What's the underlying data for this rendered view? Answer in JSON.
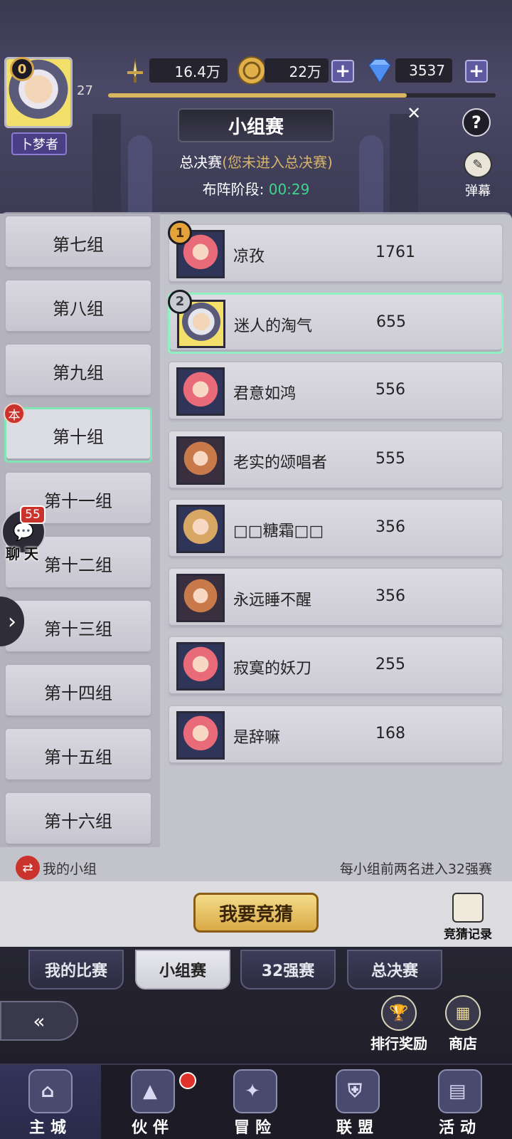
{
  "header": {
    "vip_level": "0",
    "player_title": "卜梦者",
    "level": "27",
    "xp_fraction": 0.77,
    "power": "16.4万",
    "gold": "22万",
    "diamonds": "3537",
    "plus_symbol": "+",
    "page_title": "小组赛",
    "help_symbol": "?",
    "close_symbol": "✕",
    "barrage_label": "弹幕",
    "stage_prefix": "总决赛",
    "stage_note": "(您未进入总决赛)",
    "phase_label": "布阵阶段:",
    "phase_timer": "00:29"
  },
  "groups": [
    {
      "label": "第七组"
    },
    {
      "label": "第八组"
    },
    {
      "label": "第九组"
    },
    {
      "label": "第十组",
      "active": true
    },
    {
      "label": "第十一组"
    },
    {
      "label": "第十二组"
    },
    {
      "label": "第十三组"
    },
    {
      "label": "第十四组"
    },
    {
      "label": "第十五组"
    },
    {
      "label": "第十六组"
    }
  ],
  "self_badge": "本",
  "ranking": [
    {
      "name": "凉孜",
      "score": "1761",
      "medal": "1",
      "avatar": "pink"
    },
    {
      "name": "迷人的淘气",
      "score": "655",
      "medal": "2",
      "avatar": "white",
      "mine": true
    },
    {
      "name": "君意如鸿",
      "score": "556",
      "avatar": "pink"
    },
    {
      "name": "老实的颂唱者",
      "score": "555",
      "avatar": "orange"
    },
    {
      "name": "□□糖霜□□",
      "score": "356",
      "avatar": "blond"
    },
    {
      "name": "永远睡不醒",
      "score": "356",
      "avatar": "orange"
    },
    {
      "name": "寂寞的妖刀",
      "score": "255",
      "avatar": "pink"
    },
    {
      "name": "是辞嘛",
      "score": "168",
      "avatar": "pink"
    }
  ],
  "chat": {
    "badge": "55",
    "label": "聊天"
  },
  "footer_info": {
    "my_group": "我的小组",
    "rule": "每小组前两名进入32强赛"
  },
  "guess": {
    "button": "我要竞猜",
    "record": "竞猜记录"
  },
  "tabs": [
    {
      "label": "我的比赛"
    },
    {
      "label": "小组赛",
      "active": true
    },
    {
      "label": "32强赛"
    },
    {
      "label": "总决赛"
    }
  ],
  "utilities": {
    "rank_reward": "排行奖励",
    "shop": "商店"
  },
  "nav": [
    {
      "label": "主城",
      "icon": "castle-icon",
      "active": true
    },
    {
      "label": "伙伴",
      "icon": "witch-hat-icon"
    },
    {
      "label": "冒险",
      "icon": "compass-icon"
    },
    {
      "label": "联盟",
      "icon": "shield-icon"
    },
    {
      "label": "活动",
      "icon": "cards-icon"
    }
  ],
  "colors": {
    "timer": "#3ed68a",
    "stage_note": "#d6b36a",
    "active_border": "#7fe6b4",
    "badge_red": "#c9332b"
  }
}
